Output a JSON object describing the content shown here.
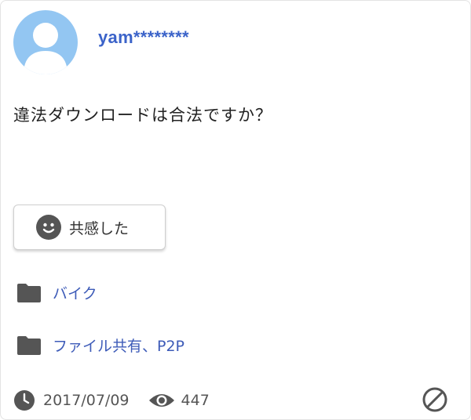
{
  "post": {
    "username": "yam********",
    "question": "違法ダウンロードは合法ですか？",
    "empathy_label": "共感した",
    "categories": [
      {
        "label": "バイク",
        "icon": "folder-icon"
      },
      {
        "label": "ファイル共有、P2P",
        "icon": "folder-icon"
      }
    ],
    "date": "2017/07/09",
    "views": "447"
  },
  "colors": {
    "avatar_bg": "#93c6f2",
    "username": "#3b63c9",
    "link": "#3d5bb8",
    "icon_gray": "#555555"
  }
}
